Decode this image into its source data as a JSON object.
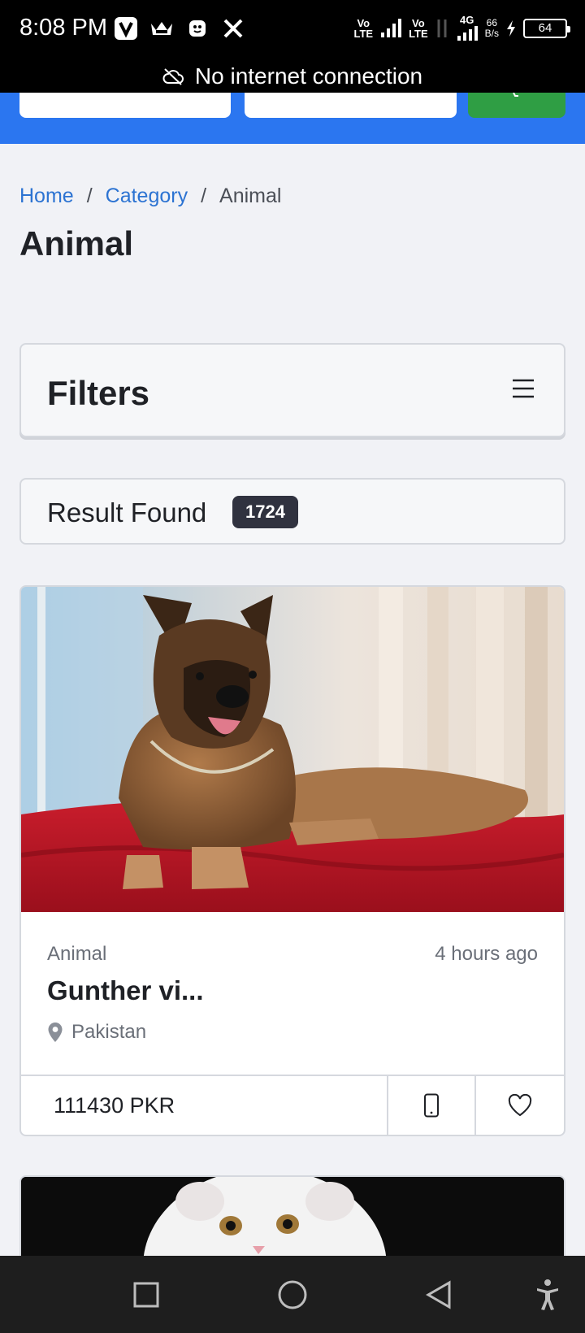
{
  "status_bar": {
    "time": "8:08 PM",
    "network1": "Vo\nLTE",
    "network2": "Vo\nLTE",
    "network_type": "4G",
    "speed_value": "66",
    "speed_unit": "B/s",
    "battery": "64"
  },
  "offline_banner": {
    "text": "No internet connection"
  },
  "breadcrumb": {
    "home": "Home",
    "category": "Category",
    "current": "Animal",
    "separator": "/"
  },
  "page_title": "Animal",
  "filters": {
    "title": "Filters"
  },
  "results": {
    "label": "Result Found",
    "count": "1724"
  },
  "listing": {
    "category": "Animal",
    "time_ago": "4 hours ago",
    "title": "Gunther vi...",
    "location": "Pakistan",
    "price": "111430 PKR"
  },
  "colors": {
    "header_blue": "#2b76f0",
    "search_green": "#2f9e44",
    "link_blue": "#2c73d2",
    "badge_dark": "#30323f"
  },
  "icons": {
    "offline": "cloud-off-icon",
    "menu": "hamburger-menu-icon",
    "location": "map-pin-icon",
    "phone": "phone-icon",
    "favorite": "heart-icon",
    "nav_recent": "square-icon",
    "nav_home": "circle-icon",
    "nav_back": "triangle-back-icon",
    "accessibility": "accessibility-icon"
  }
}
